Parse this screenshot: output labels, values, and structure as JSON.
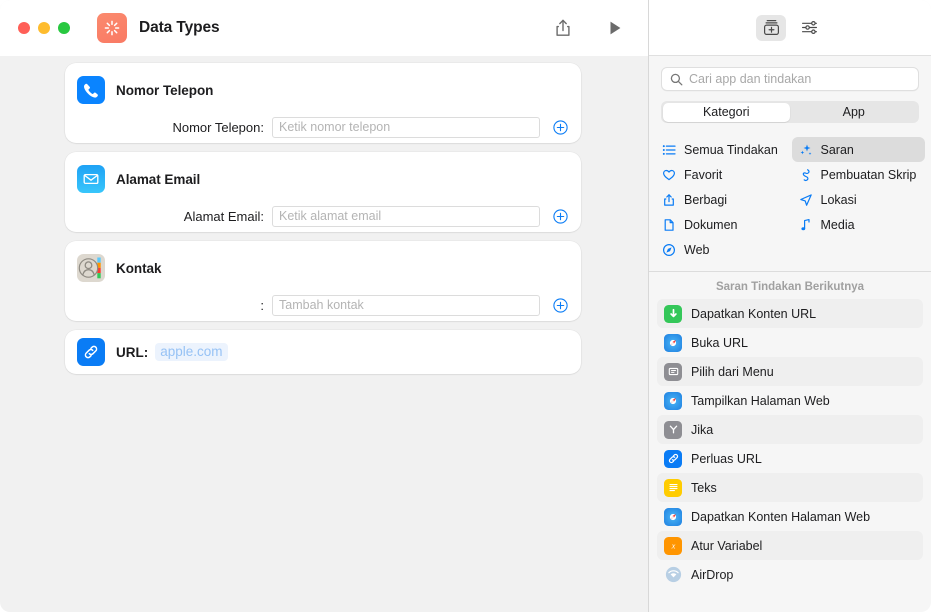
{
  "window": {
    "title": "Data Types",
    "app_icon": "shortcuts-icon",
    "traffic_lights": [
      "close",
      "minimize",
      "zoom"
    ],
    "toolbar": {
      "share_label": "share-icon",
      "run_label": "play-icon"
    }
  },
  "editor": {
    "cards": [
      {
        "icon": "phone-icon",
        "title": "Nomor Telepon",
        "row_label": "Nomor Telepon:",
        "placeholder": "Ketik nomor telepon",
        "add_label": "add-icon"
      },
      {
        "icon": "mail-icon",
        "title": "Alamat Email",
        "row_label": "Alamat Email:",
        "placeholder": "Ketik alamat email",
        "add_label": "add-icon"
      },
      {
        "icon": "contacts-icon",
        "title": "Kontak",
        "row_label": ":",
        "placeholder": "Tambah kontak",
        "add_label": "add-icon"
      }
    ],
    "url_card": {
      "icon": "link-icon",
      "label": "URL:",
      "token": "apple.com"
    }
  },
  "library": {
    "toolbar": {
      "action_library_label": "action-library-icon",
      "settings_label": "sliders-icon"
    },
    "search": {
      "placeholder": "Cari app dan tindakan",
      "value": ""
    },
    "segmented": {
      "options": [
        "Kategori",
        "App"
      ],
      "selected": "Kategori"
    },
    "categories": [
      {
        "label": "Semua Tindakan",
        "icon": "list-icon",
        "selected": false
      },
      {
        "label": "Saran",
        "icon": "sparkles-icon",
        "selected": true
      },
      {
        "label": "Favorit",
        "icon": "heart-icon",
        "selected": false
      },
      {
        "label": "Pembuatan Skrip",
        "icon": "scripting-icon",
        "selected": false
      },
      {
        "label": "Berbagi",
        "icon": "share-icon",
        "selected": false
      },
      {
        "label": "Lokasi",
        "icon": "location-arrow-icon",
        "selected": false
      },
      {
        "label": "Dokumen",
        "icon": "document-icon",
        "selected": false
      },
      {
        "label": "Media",
        "icon": "music-note-icon",
        "selected": false
      },
      {
        "label": "Web",
        "icon": "compass-icon",
        "selected": false
      }
    ],
    "suggestions_header": "Saran Tindakan Berikutnya",
    "suggestions": [
      {
        "label": "Dapatkan Konten URL",
        "icon": "download-icon",
        "color": "#34c759"
      },
      {
        "label": "Buka URL",
        "icon": "safari-icon",
        "color": "#1f7fe0"
      },
      {
        "label": "Pilih dari Menu",
        "icon": "menu-icon",
        "color": "#8e8e93"
      },
      {
        "label": "Tampilkan Halaman Web",
        "icon": "safari-icon",
        "color": "#1f7fe0"
      },
      {
        "label": "Jika",
        "icon": "branch-icon",
        "color": "#8e8e93"
      },
      {
        "label": "Perluas URL",
        "icon": "link-icon",
        "color": "#0a7cf5"
      },
      {
        "label": "Teks",
        "icon": "text-icon",
        "color": "#ffcc00"
      },
      {
        "label": "Dapatkan Konten Halaman Web",
        "icon": "safari-icon",
        "color": "#1f7fe0"
      },
      {
        "label": "Atur Variabel",
        "icon": "variable-icon",
        "color": "#ff9500"
      },
      {
        "label": "AirDrop",
        "icon": "airdrop-icon",
        "color": "#9bb8d6"
      }
    ]
  },
  "colors": {
    "accent_blue": "#0a7cf5",
    "window_bg": "#f1f1f1",
    "sidebar_bg": "#f6f6f6",
    "card_bg": "#ffffff",
    "shortcuts_orange": "#f97a64"
  }
}
